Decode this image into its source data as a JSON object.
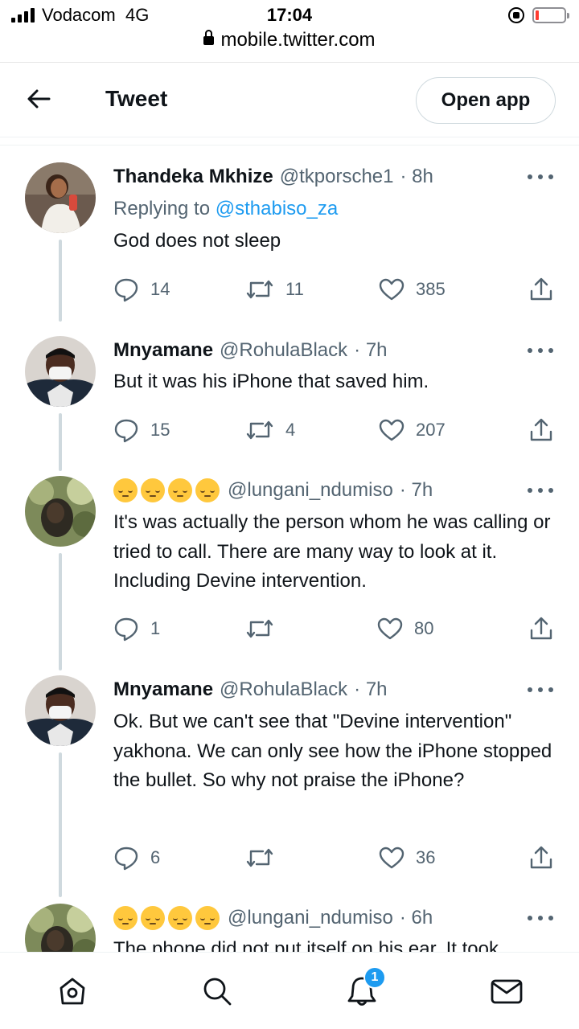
{
  "status_bar": {
    "carrier": "Vodacom",
    "network": "4G",
    "time": "17:04",
    "url": "mobile.twitter.com",
    "battery_color": "#ff3b30"
  },
  "header": {
    "title": "Tweet",
    "open_app_label": "Open app",
    "back_icon": "arrow-left-icon"
  },
  "tweets": [
    {
      "name": "Thandeka Mkhize",
      "handle": "@tkporsche1",
      "time": "· 8h",
      "replying_prefix": "Replying to ",
      "replying_handle": "@sthabiso_za",
      "text": "God does not sleep",
      "replies": "14",
      "retweets": "11",
      "likes": "385"
    },
    {
      "name": "Mnyamane",
      "handle": "@RohulaBlack",
      "time": "· 7h",
      "text": "But it was his iPhone that saved him.",
      "replies": "15",
      "retweets": "4",
      "likes": "207"
    },
    {
      "name_emoji": "😔😔😔😔",
      "handle": "@lungani_ndumiso",
      "time": "· 7h",
      "text": "It's was actually the person whom he was calling or tried to call. There are many way to look at it. Including Devine intervention.",
      "replies": "1",
      "retweets": "",
      "likes": "80"
    },
    {
      "name": "Mnyamane",
      "handle": "@RohulaBlack",
      "time": "· 7h",
      "text": "Ok. But we can't see that \"Devine intervention\" yakhona. We can only see how the iPhone stopped the bullet. So why not praise the iPhone?",
      "replies": "6",
      "retweets": "",
      "likes": "36"
    },
    {
      "name_emoji": "😔😔😔😔",
      "handle": "@lungani_ndumiso",
      "time": "· 6h",
      "text": "The phone did not put itself on his ear. It took"
    }
  ],
  "bottom_nav": {
    "items": [
      "home-icon",
      "search-icon",
      "notifications-icon",
      "messages-icon"
    ],
    "notification_count": "1"
  },
  "colors": {
    "accent": "#1d9bf0",
    "secondary_text": "#536471",
    "primary_text": "#0f1419",
    "thread_line": "#cfd9de"
  }
}
